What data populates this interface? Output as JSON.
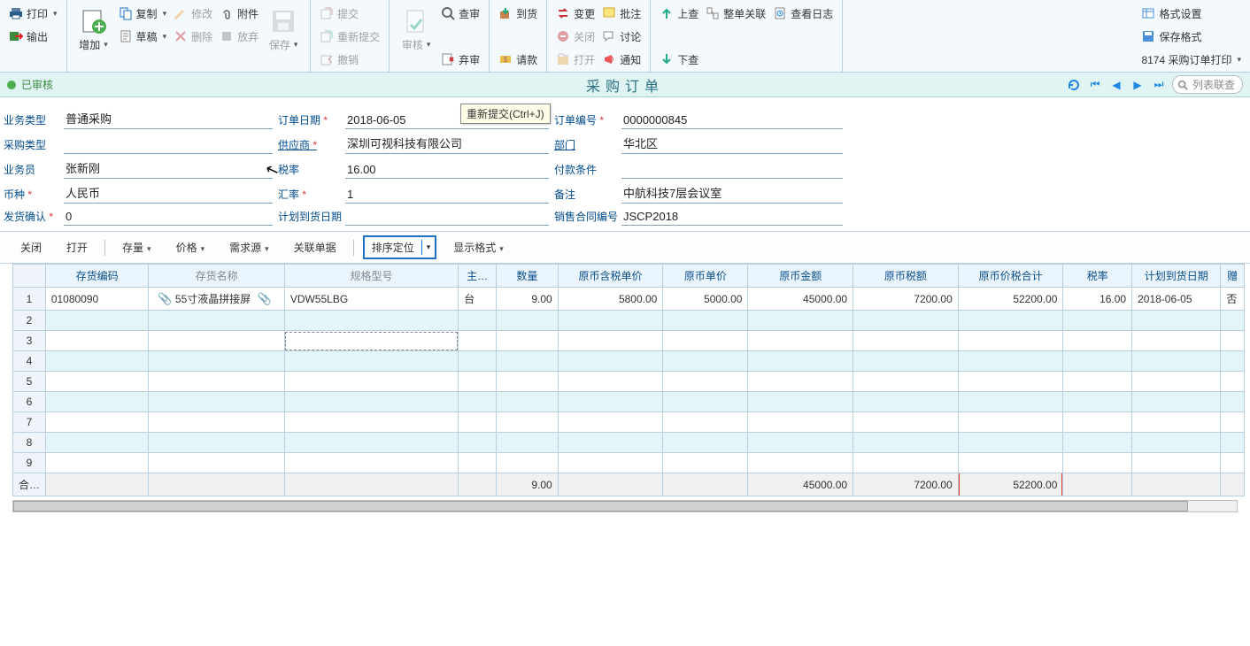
{
  "ribbon": {
    "print": "打印",
    "output": "输出",
    "add": "增加",
    "copy": "复制",
    "draft": "草稿",
    "modify": "修改",
    "delete": "删除",
    "attachment": "附件",
    "discard": "放弃",
    "save": "保存",
    "submit": "提交",
    "resubmit": "重新提交",
    "unsubmit": "撤销",
    "approve": "审核",
    "unapprove": "弃审",
    "review": "查审",
    "arrival": "到货",
    "request": "请款",
    "change": "变更",
    "close": "关闭",
    "open2": "打开",
    "annotate": "批注",
    "discuss": "讨论",
    "notify": "通知",
    "upcheck": "上查",
    "downcheck": "下查",
    "wholelink": "整单关联",
    "viewlog": "查看日志",
    "formatset": "格式设置",
    "saveformat": "保存格式",
    "printtpl": "8174 采购订单打印"
  },
  "status": {
    "state": "已审核",
    "title": "采购订单",
    "search_placeholder": "列表联查"
  },
  "header": {
    "labels": {
      "bizType": "业务类型",
      "orderDate": "订单日期",
      "orderNo": "订单编号",
      "purchaseType": "采购类型",
      "supplier": "供应商",
      "dept": "部门",
      "salesman": "业务员",
      "taxrate": "税率",
      "payterm": "付款条件",
      "currency": "币种",
      "exrate": "汇率",
      "remark": "备注",
      "shipconfirm": "发货确认",
      "plandate": "计划到货日期",
      "contractno": "销售合同编号"
    },
    "values": {
      "bizType": "普通采购",
      "orderDate": "2018-06-05",
      "orderNo": "0000000845",
      "purchaseType": "",
      "supplier": "深圳可视科技有限公司",
      "dept": "华北区",
      "salesman": "张新刚",
      "taxrate": "16.00",
      "payterm": "",
      "currency": "人民币",
      "exrate": "1",
      "remark": "中航科技7层会议室",
      "shipconfirm": "0",
      "plandate": "",
      "contractno": "JSCP2018"
    },
    "tooltip": "重新提交(Ctrl+J)"
  },
  "gridbar": {
    "close": "关闭",
    "open": "打开",
    "stock": "存量",
    "price": "价格",
    "demand": "需求源",
    "related": "关联单据",
    "sort": "排序定位",
    "display": "显示格式"
  },
  "table": {
    "headers": {
      "code": "存货编码",
      "name": "存货名称",
      "spec": "规格型号",
      "unit": "主…",
      "qty": "数量",
      "taxprice": "原币含税单价",
      "price": "原币单价",
      "amount": "原币金额",
      "tax": "原币税额",
      "total": "原币价税合计",
      "rate": "税率",
      "plandate": "计划到货日期",
      "flag": "赠"
    },
    "rows": [
      {
        "code": "01080090",
        "name": "55寸液晶拼接屏",
        "spec": "VDW55LBG",
        "unit": "台",
        "qty": "9.00",
        "taxprice": "5800.00",
        "price": "5000.00",
        "amount": "45000.00",
        "tax": "7200.00",
        "total": "52200.00",
        "rate": "16.00",
        "plandate": "2018-06-05",
        "flag": "否"
      }
    ],
    "empty_rows": 8,
    "footer_label": "合计",
    "footer": {
      "qty": "9.00",
      "amount": "45000.00",
      "tax": "7200.00",
      "total": "52200.00"
    }
  }
}
